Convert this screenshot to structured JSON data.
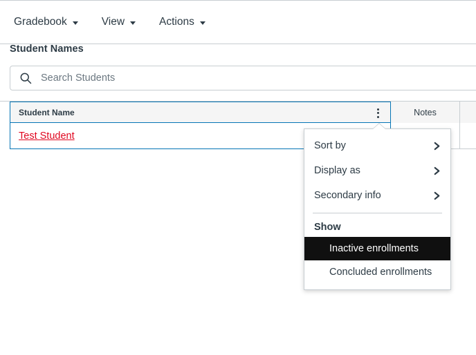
{
  "toolbar": {
    "menus": [
      {
        "label": "Gradebook",
        "icon": "chevron-down-icon"
      },
      {
        "label": "View",
        "icon": "chevron-down-icon"
      },
      {
        "label": "Actions",
        "icon": "chevron-down-icon"
      }
    ]
  },
  "section": {
    "heading": "Student Names"
  },
  "search": {
    "icon": "search-icon",
    "placeholder": "Search Students",
    "value": ""
  },
  "table": {
    "columns": [
      {
        "label": "Student Name",
        "key": "student_name"
      },
      {
        "label": "Notes",
        "key": "notes"
      }
    ],
    "column_menu_icon": "kebab-menu-icon",
    "rows": [
      {
        "student_name": "Test Student",
        "notes": ""
      }
    ]
  },
  "column_menu": {
    "items": [
      {
        "label": "Sort by",
        "icon": "chevron-right-icon",
        "has_submenu": true
      },
      {
        "label": "Display as",
        "icon": "chevron-right-icon",
        "has_submenu": true
      },
      {
        "label": "Secondary info",
        "icon": "chevron-right-icon",
        "has_submenu": true
      }
    ],
    "group_label": "Show",
    "options": [
      {
        "label": "Inactive enrollments",
        "selected": true
      },
      {
        "label": "Concluded enrollments",
        "selected": false
      }
    ]
  },
  "colors": {
    "link": "#E0061F",
    "focus_border": "#0374B5",
    "header_bg": "#F5F5F5",
    "border": "#C7CDD1",
    "highlight_bg": "#101010",
    "text": "#2D3B45"
  }
}
